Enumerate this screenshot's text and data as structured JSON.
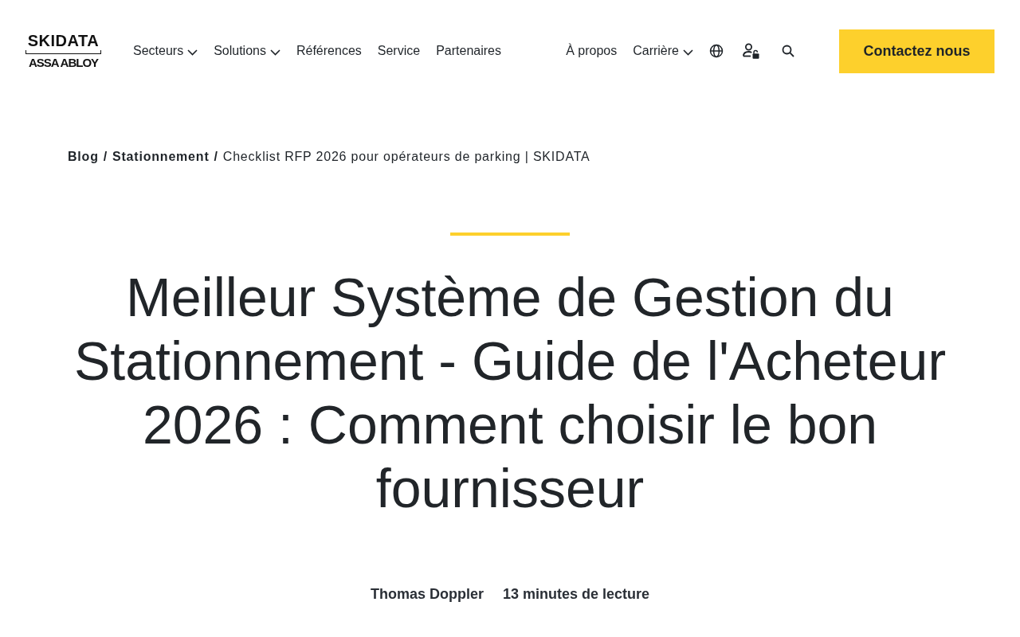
{
  "header": {
    "logo": {
      "wordmark": "SKIDATA",
      "group": "ASSA ABLOY"
    },
    "nav": [
      {
        "label": "Secteurs",
        "dropdown": true
      },
      {
        "label": "Solutions",
        "dropdown": true
      },
      {
        "label": "Références",
        "dropdown": false
      },
      {
        "label": "Service",
        "dropdown": false
      },
      {
        "label": "Partenaires",
        "dropdown": false
      }
    ],
    "secondary_nav": [
      {
        "label": "À propos",
        "dropdown": false
      },
      {
        "label": "Carrière",
        "dropdown": true
      }
    ],
    "contact_button": "Contactez nous"
  },
  "breadcrumb": {
    "items": [
      {
        "label": "Blog",
        "current": false
      },
      {
        "label": "Stationnement",
        "current": false
      },
      {
        "label": "Checklist RFP 2026 pour opérateurs de parking | SKIDATA",
        "current": true
      }
    ],
    "separators": [
      "/",
      "/"
    ]
  },
  "article": {
    "title": "Meilleur Système de Gestion du Stationnement - Guide de l'Acheteur 2026 : Comment choisir le bon fournisseur",
    "author": "Thomas Doppler",
    "read_time": "13 minutes de lecture"
  }
}
